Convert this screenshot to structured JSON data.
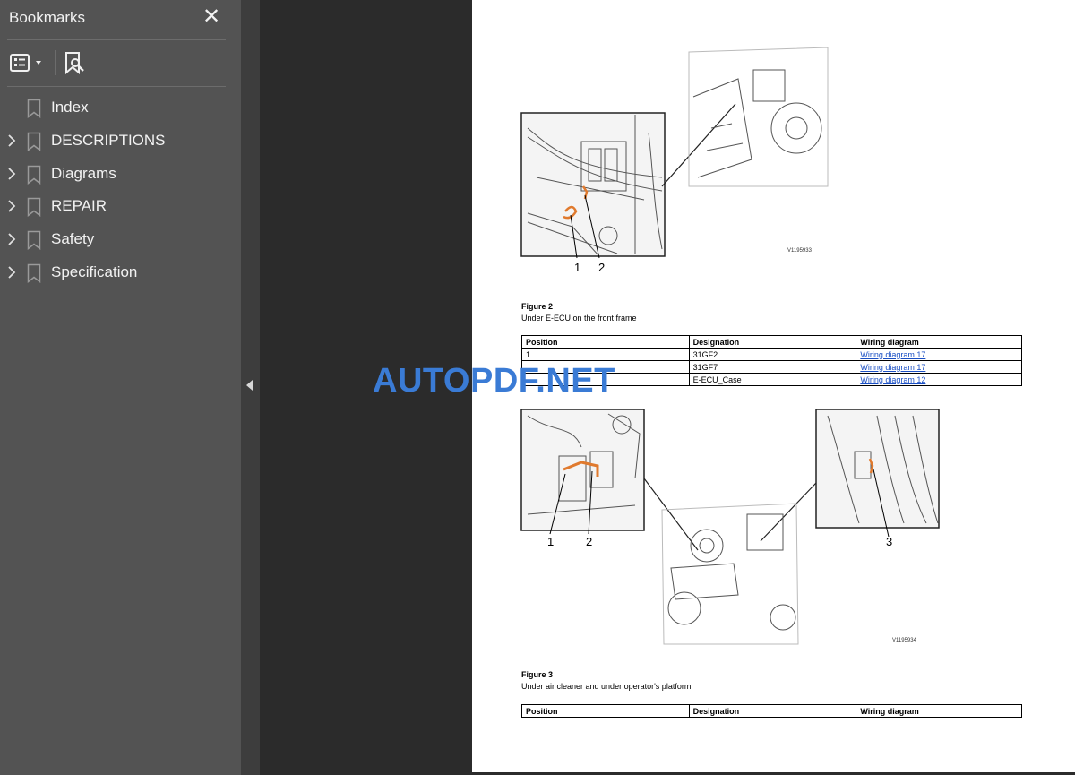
{
  "sidebar": {
    "title": "Bookmarks",
    "close_glyph": "✕",
    "tools": {
      "options_icon": "bookmark-options-icon",
      "find_icon": "find-current-bookmark-icon"
    },
    "items": [
      {
        "label": "Index",
        "expandable": false
      },
      {
        "label": "DESCRIPTIONS",
        "expandable": true
      },
      {
        "label": "Diagrams",
        "expandable": true
      },
      {
        "label": "REPAIR",
        "expandable": true
      },
      {
        "label": "Safety",
        "expandable": true
      },
      {
        "label": "Specification",
        "expandable": true
      }
    ]
  },
  "page": {
    "figure2": {
      "callouts": [
        "1",
        "2"
      ],
      "image_id": "V1195933",
      "title": "Figure 2",
      "caption": "Under E-ECU on the front frame"
    },
    "table1": {
      "headers": [
        "Position",
        "Designation",
        "Wiring diagram"
      ],
      "rows": [
        {
          "position": "1",
          "designation": "31GF2",
          "wiring": "Wiring diagram 17"
        },
        {
          "position": "",
          "designation": "31GF7",
          "wiring": "Wiring diagram 17"
        },
        {
          "position": "",
          "designation": "E-ECU_Case",
          "wiring": "Wiring diagram 12"
        }
      ]
    },
    "figure3": {
      "callouts": [
        "1",
        "2",
        "3"
      ],
      "image_id": "V1195934",
      "title": "Figure 3",
      "caption": "Under air cleaner and under operator's platform"
    },
    "table2": {
      "headers": [
        "Position",
        "Designation",
        "Wiring diagram"
      ]
    }
  },
  "watermark": "AUTOPDF.NET",
  "colors": {
    "sidebar_bg": "#535353",
    "doc_bg": "#2b2b2b",
    "link": "#1a4fc4",
    "watermark": "#3a7bd5",
    "highlight_orange": "#e07a2e"
  }
}
